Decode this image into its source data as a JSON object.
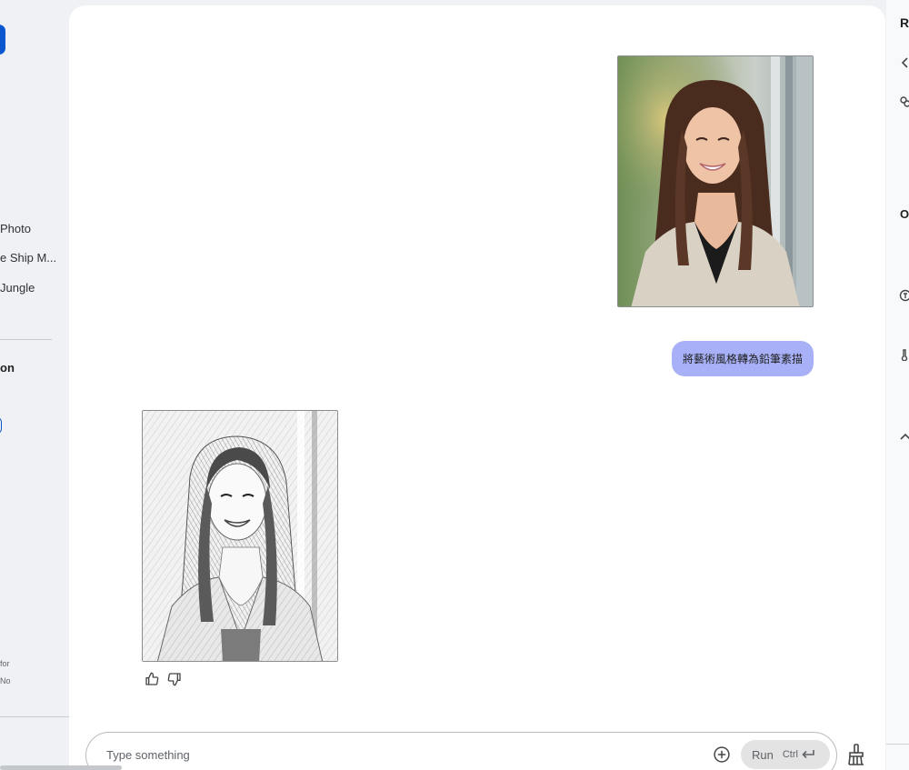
{
  "sidebar": {
    "items": [
      {
        "label": "Photo"
      },
      {
        "label": "e Ship M..."
      },
      {
        "label": "Jungle"
      }
    ],
    "section_heading": "on",
    "footer_lines": [
      "for",
      "No"
    ]
  },
  "chat": {
    "user_message": "將藝術風格轉為鉛筆素描",
    "user_image_alt": "Color photo of a smiling woman with long hair in a knit cardigan",
    "model_image_alt": "Pencil sketch of the same smiling woman"
  },
  "composer": {
    "placeholder": "Type something",
    "run_label": "Run",
    "shortcut_label": "Ctrl"
  },
  "right_panel": {
    "title": "R",
    "heading": "O"
  },
  "icons": {
    "thumbs_up": "thumb-up-icon",
    "thumbs_down": "thumb-down-icon",
    "add": "add-circle-icon",
    "enter": "enter-key-icon",
    "clear": "broom-icon"
  },
  "colors": {
    "accent": "#0b57d0",
    "user_bubble": "#a8b1f7",
    "background": "#eff1f4",
    "panel": "#ffffff"
  }
}
